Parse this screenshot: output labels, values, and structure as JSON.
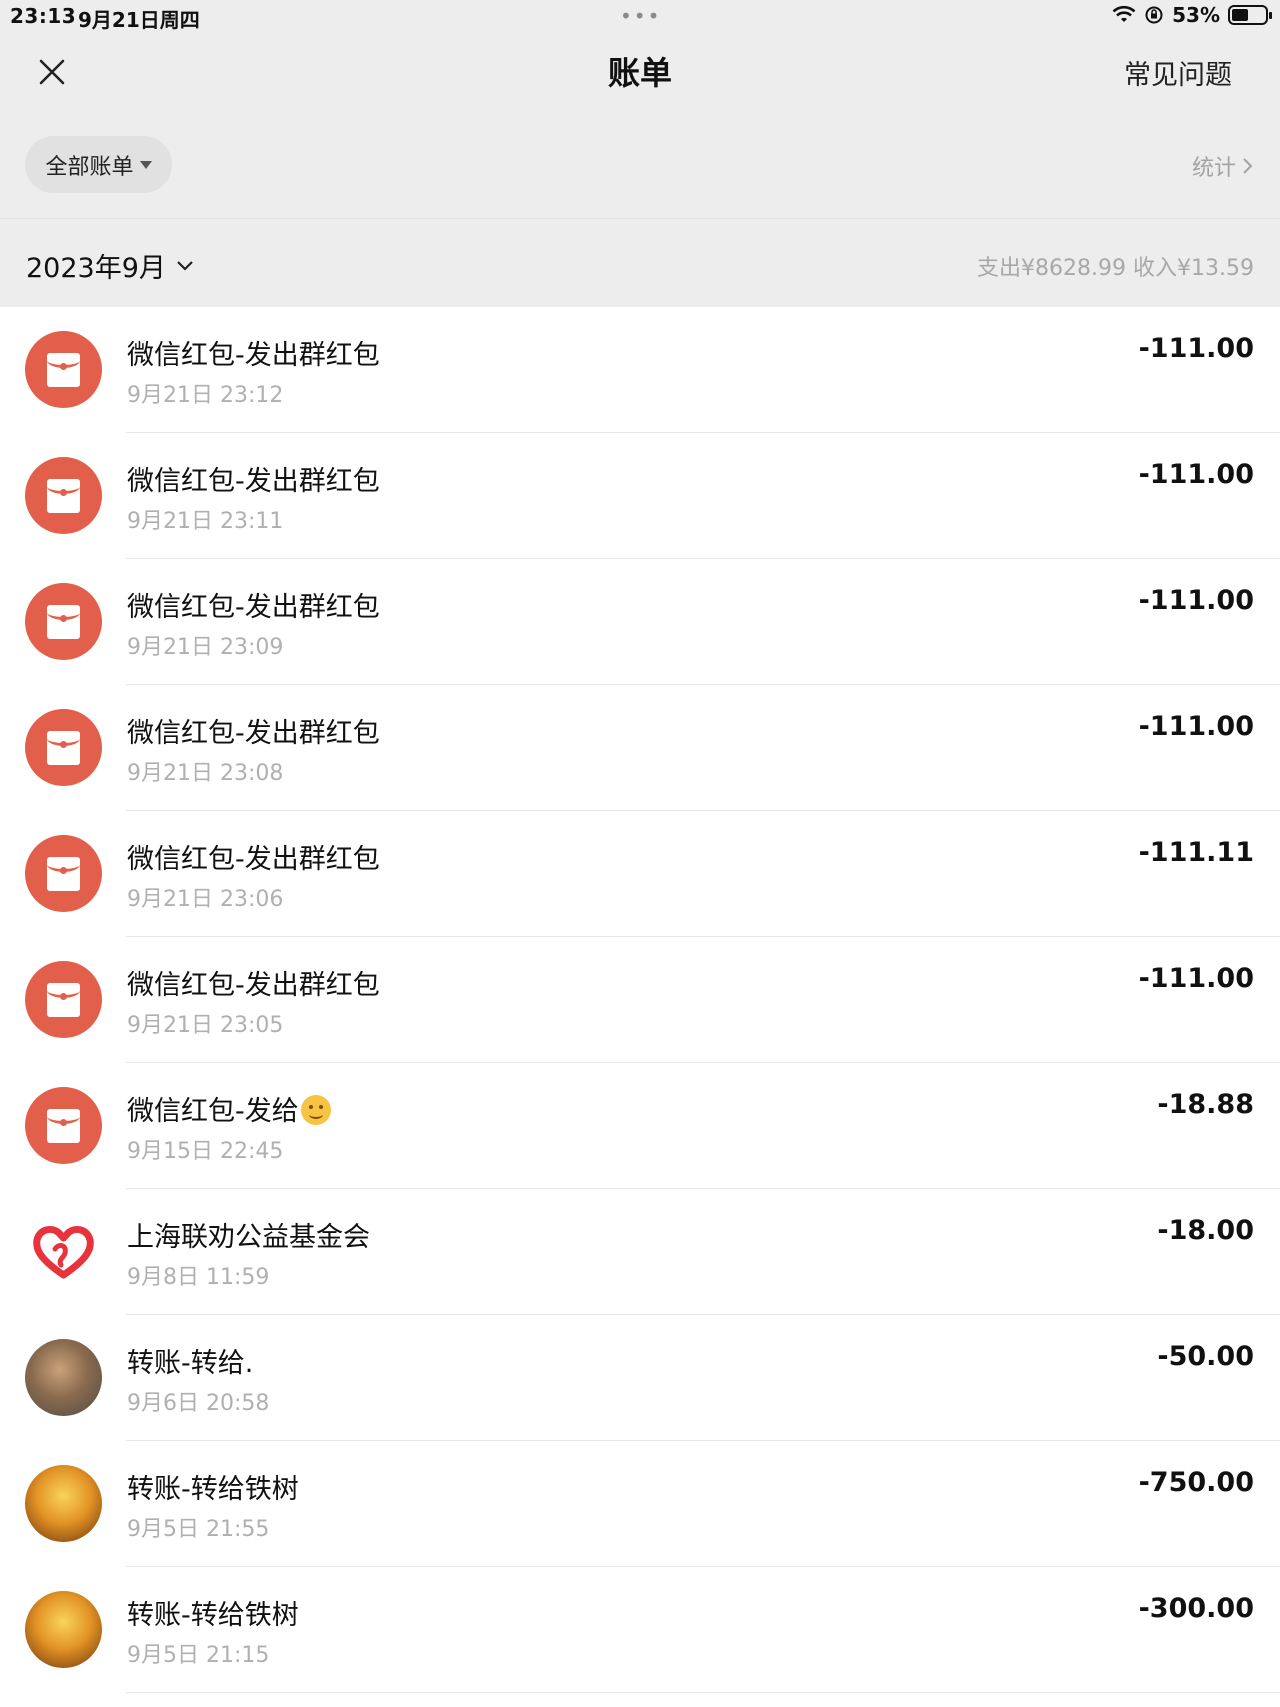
{
  "status_bar": {
    "time": "23:13",
    "date": "9月21日周四",
    "battery": "53%"
  },
  "nav": {
    "title": "账单",
    "faq_label": "常见问题"
  },
  "filter": {
    "label": "全部账单",
    "stats_label": "统计"
  },
  "month": {
    "label": "2023年9月",
    "summary": "支出¥8628.99  收入¥13.59"
  },
  "transactions": [
    {
      "icon": "red-packet-icon",
      "title": "微信红包-发出群红包",
      "time": "9月21日 23:12",
      "amount": "-111.00"
    },
    {
      "icon": "red-packet-icon",
      "title": "微信红包-发出群红包",
      "time": "9月21日 23:11",
      "amount": "-111.00"
    },
    {
      "icon": "red-packet-icon",
      "title": "微信红包-发出群红包",
      "time": "9月21日 23:09",
      "amount": "-111.00"
    },
    {
      "icon": "red-packet-icon",
      "title": "微信红包-发出群红包",
      "time": "9月21日 23:08",
      "amount": "-111.00"
    },
    {
      "icon": "red-packet-icon",
      "title": "微信红包-发出群红包",
      "time": "9月21日 23:06",
      "amount": "-111.11"
    },
    {
      "icon": "red-packet-icon",
      "title": "微信红包-发出群红包",
      "time": "9月21日 23:05",
      "amount": "-111.00"
    },
    {
      "icon": "red-packet-icon",
      "title": "微信红包-发给",
      "emoji": "smiley-emoji",
      "time": "9月15日 22:45",
      "amount": "-18.88"
    },
    {
      "icon": "charity-heart-icon",
      "title": "上海联劝公益基金会",
      "time": "9月8日 11:59",
      "amount": "-18.00"
    },
    {
      "icon": "avatar-dog",
      "title": "转账-转给.",
      "time": "9月6日 20:58",
      "amount": "-50.00"
    },
    {
      "icon": "avatar-tree",
      "title": "转账-转给铁树",
      "time": "9月5日 21:55",
      "amount": "-750.00"
    },
    {
      "icon": "avatar-tree",
      "title": "转账-转给铁树",
      "time": "9月5日 21:15",
      "amount": "-300.00"
    }
  ],
  "colors": {
    "red_packet": "#e2604b",
    "heart": "#e8323c",
    "background_top": "#ededed"
  }
}
